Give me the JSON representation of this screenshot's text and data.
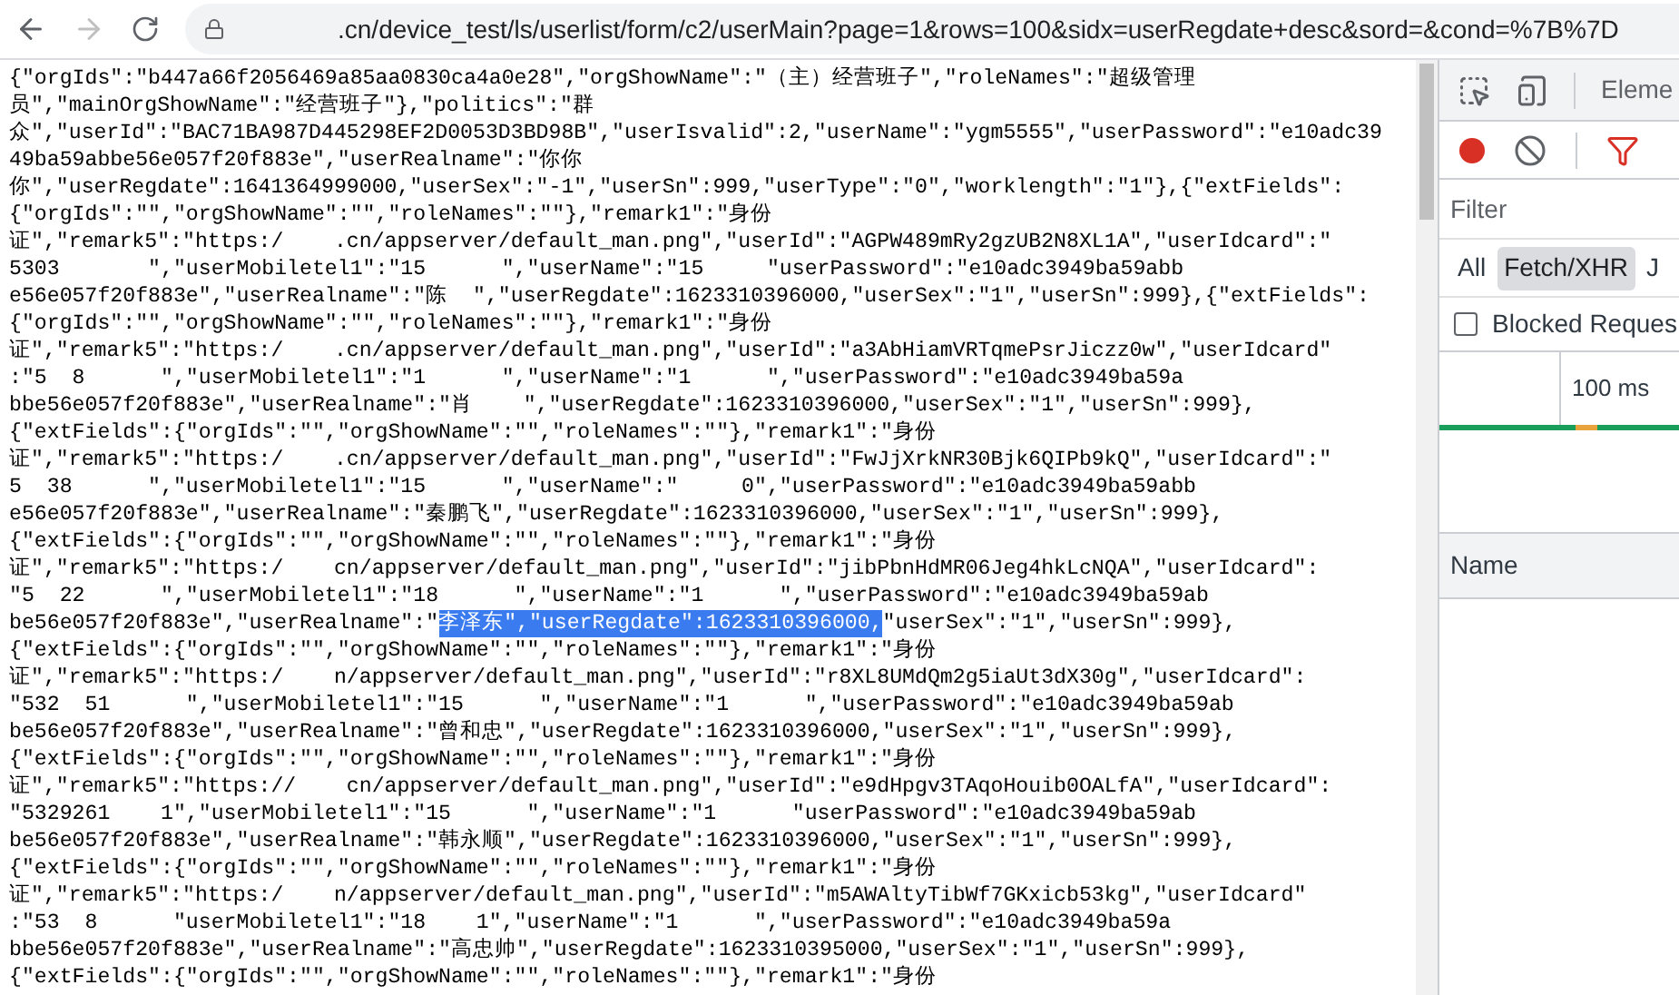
{
  "browser": {
    "url_host": ".cn/device_test/ls/userlist/form/c2/userMain?page=1&rows=100&sidx=userRegdate+desc&sord=&cond=%7B%7D",
    "forward_disabled": true
  },
  "response_lines": [
    {
      "text": "{\"orgIds\":\"b447a66f2056469a85aa0830ca4a0e28\",\"orgShowName\":\"（主）经营班子\",\"roleNames\":\"超级管理"
    },
    {
      "text": "员\",\"mainOrgShowName\":\"经营班子\"},\"politics\":\"群"
    },
    {
      "text": "众\",\"userId\":\"BAC71BA987D445298EF2D0053D3BD98B\",\"userIsvalid\":2,\"userName\":\"ygm5555\",\"userPassword\":\"e10adc39"
    },
    {
      "text": "49ba59abbe56e057f20f883e\",\"userRealname\":\"你你"
    },
    {
      "text": "你\",\"userRegdate\":1641364999000,\"userSex\":\"-1\",\"userSn\":999,\"userType\":\"0\",\"worklength\":\"1\"},{\"extFields\":"
    },
    {
      "text": "{\"orgIds\":\"\",\"orgShowName\":\"\",\"roleNames\":\"\"},\"remark1\":\"身份"
    },
    {
      "text": "证\",\"remark5\":\"https:/    .cn/appserver/default_man.png\",\"userId\":\"AGPW489mRy2gzUB2N8XL1A\",\"userIdcard\":\""
    },
    {
      "text": "5303       \",\"userMobiletel1\":\"15      \",\"userName\":\"15     \"userPassword\":\"e10adc3949ba59abb"
    },
    {
      "text": "e56e057f20f883e\",\"userRealname\":\"陈  \",\"userRegdate\":1623310396000,\"userSex\":\"1\",\"userSn\":999},{\"extFields\":"
    },
    {
      "text": "{\"orgIds\":\"\",\"orgShowName\":\"\",\"roleNames\":\"\"},\"remark1\":\"身份"
    },
    {
      "text": "证\",\"remark5\":\"https:/    .cn/appserver/default_man.png\",\"userId\":\"a3AbHiamVRTqmePsrJiczz0w\",\"userIdcard\""
    },
    {
      "text": ":\"5  8      \",\"userMobiletel1\":\"1      \",\"userName\":\"1      \",\"userPassword\":\"e10adc3949ba59a"
    },
    {
      "text": "bbe56e057f20f883e\",\"userRealname\":\"肖    \",\"userRegdate\":1623310396000,\"userSex\":\"1\",\"userSn\":999},"
    },
    {
      "text": "{\"extFields\":{\"orgIds\":\"\",\"orgShowName\":\"\",\"roleNames\":\"\"},\"remark1\":\"身份"
    },
    {
      "text": "证\",\"remark5\":\"https:/    .cn/appserver/default_man.png\",\"userId\":\"FwJjXrkNR30Bjk6QIPb9kQ\",\"userIdcard\":\""
    },
    {
      "text": "5  38      \",\"userMobiletel1\":\"15      \",\"userName\":\"     0\",\"userPassword\":\"e10adc3949ba59abb"
    },
    {
      "text": "e56e057f20f883e\",\"userRealname\":\"秦鹏飞\",\"userRegdate\":1623310396000,\"userSex\":\"1\",\"userSn\":999},"
    },
    {
      "text": "{\"extFields\":{\"orgIds\":\"\",\"orgShowName\":\"\",\"roleNames\":\"\"},\"remark1\":\"身份"
    },
    {
      "text": "证\",\"remark5\":\"https:/    cn/appserver/default_man.png\",\"userId\":\"jibPbnHdMR06Jeg4hkLcNQA\",\"userIdcard\":"
    },
    {
      "text": "\"5  22      \",\"userMobiletel1\":\"18      \",\"userName\":\"1      \",\"userPassword\":\"e10adc3949ba59ab"
    },
    {
      "segments": [
        {
          "text": "be56e057f20f883e\",\"userRealname\":\"",
          "selected": false
        },
        {
          "text": "李泽东\",\"userRegdate\":1623310396000,",
          "selected": true
        },
        {
          "text": "\"userSex\":\"1\",\"userSn\":999},",
          "selected": false
        }
      ]
    },
    {
      "text": "{\"extFields\":{\"orgIds\":\"\",\"orgShowName\":\"\",\"roleNames\":\"\"},\"remark1\":\"身份"
    },
    {
      "text": "证\",\"remark5\":\"https:/    n/appserver/default_man.png\",\"userId\":\"r8XL8UMdQm2g5iaUt3dX30g\",\"userIdcard\":"
    },
    {
      "text": "\"532  51      \",\"userMobiletel1\":\"15      \",\"userName\":\"1      \",\"userPassword\":\"e10adc3949ba59ab"
    },
    {
      "text": "be56e057f20f883e\",\"userRealname\":\"曾和忠\",\"userRegdate\":1623310396000,\"userSex\":\"1\",\"userSn\":999},"
    },
    {
      "text": "{\"extFields\":{\"orgIds\":\"\",\"orgShowName\":\"\",\"roleNames\":\"\"},\"remark1\":\"身份"
    },
    {
      "text": "证\",\"remark5\":\"https://    cn/appserver/default_man.png\",\"userId\":\"e9dHpgv3TAqoHouib0OALfA\",\"userIdcard\":"
    },
    {
      "text": "\"5329261    1\",\"userMobiletel1\":\"15      \",\"userName\":\"1      \"userPassword\":\"e10adc3949ba59ab"
    },
    {
      "text": "be56e057f20f883e\",\"userRealname\":\"韩永顺\",\"userRegdate\":1623310396000,\"userSex\":\"1\",\"userSn\":999},"
    },
    {
      "text": "{\"extFields\":{\"orgIds\":\"\",\"orgShowName\":\"\",\"roleNames\":\"\"},\"remark1\":\"身份"
    },
    {
      "text": "证\",\"remark5\":\"https:/    n/appserver/default_man.png\",\"userId\":\"m5AWAltyTibWf7GKxicb53kg\",\"userIdcard\""
    },
    {
      "text": ":\"53  8      \"userMobiletel1\":\"18    1\",\"userName\":\"1      \",\"userPassword\":\"e10adc3949ba59a"
    },
    {
      "text": "bbe56e057f20f883e\",\"userRealname\":\"高忠帅\",\"userRegdate\":1623310395000,\"userSex\":\"1\",\"userSn\":999},"
    },
    {
      "text": "{\"extFields\":{\"orgIds\":\"\",\"orgShowName\":\"\",\"roleNames\":\"\"},\"remark1\":\"身份"
    }
  ],
  "devtools": {
    "tabs": [
      {
        "label": "Eleme"
      }
    ],
    "filter": {
      "placeholder": "Filter"
    },
    "type_filters": [
      {
        "label": "All",
        "selected": false
      },
      {
        "label": "Fetch/XHR",
        "selected": true
      },
      {
        "label": "J",
        "selected": false
      }
    ],
    "blocked_requests": {
      "label": "Blocked Reques",
      "checked": false
    },
    "timeline": {
      "tick": "100 ms"
    },
    "columns": [
      "Name"
    ]
  }
}
